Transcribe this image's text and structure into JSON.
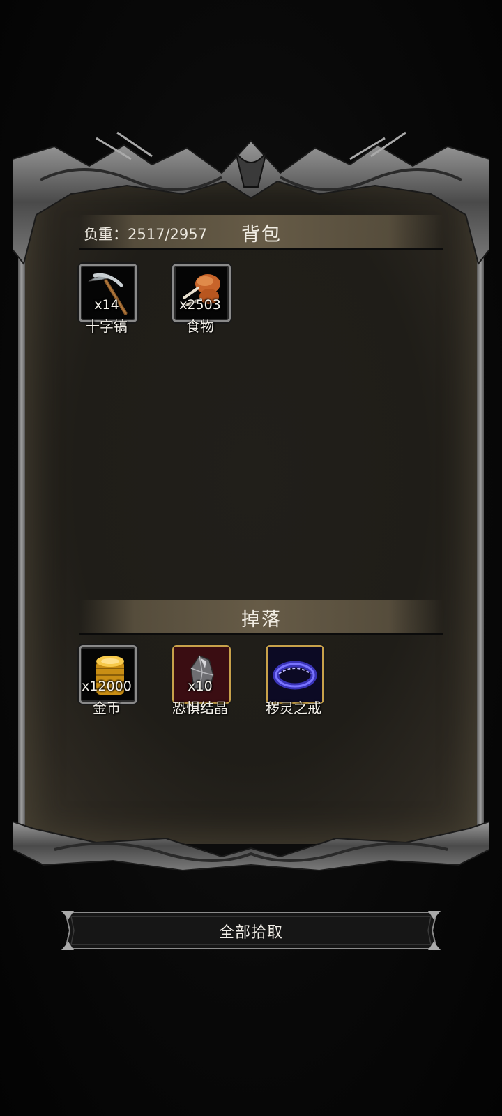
{
  "backpack": {
    "title": "背包",
    "weight_label": "负重：2517/2957",
    "items": [
      {
        "name": "十字镐",
        "count": "x14",
        "icon": "pickaxe-icon"
      },
      {
        "name": "食物",
        "count": "x2503",
        "icon": "meat-icon"
      }
    ]
  },
  "drops": {
    "title": "掉落",
    "items": [
      {
        "name": "金币",
        "count": "x12000",
        "icon": "gold-coins-icon"
      },
      {
        "name": "恐惧结晶",
        "count": "x10",
        "icon": "crystal-icon"
      },
      {
        "name": "秽灵之戒",
        "count": "",
        "icon": "ring-icon"
      }
    ]
  },
  "actions": {
    "pickup_all_label": "全部拾取"
  },
  "colors": {
    "panel_bg": "#201e19",
    "gold_border": "#c7a14a",
    "slot_border": "#8a8a8a",
    "text": "#f4f1ea"
  }
}
